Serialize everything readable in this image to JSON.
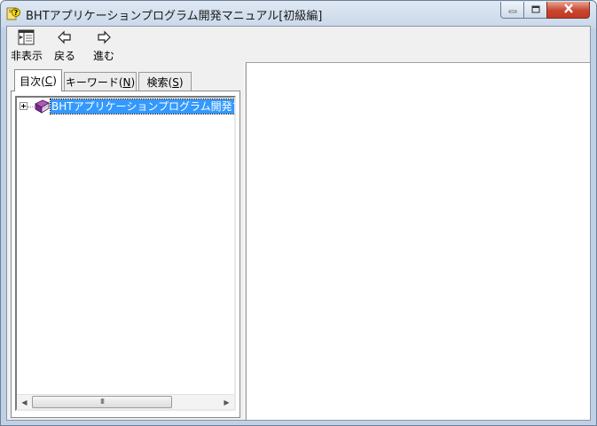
{
  "window": {
    "title": "BHTアプリケーションプログラム開発マニュアル[初級編]",
    "icons": {
      "app": "help-question-icon",
      "minimize": "minimize-icon",
      "maximize": "maximize-icon",
      "close": "close-icon"
    }
  },
  "toolbar": {
    "hide_label": "非表示",
    "back_label": "戻る",
    "forward_label": "進む",
    "icons": {
      "hide": "hide-pane-icon",
      "back": "back-arrow-icon",
      "forward": "forward-arrow-icon"
    }
  },
  "tabs": {
    "contents": {
      "text": "目次(",
      "key": "C",
      "end": ")"
    },
    "keyword": {
      "text": "キーワード(",
      "key": "N",
      "end": ")"
    },
    "search": {
      "text": "検索(",
      "key": "S",
      "end": ")"
    },
    "active": "contents"
  },
  "tree": {
    "nodes": [
      {
        "label": "BHTアプリケーションプログラム開発マニュ",
        "icon": "book-icon",
        "expanded": false,
        "selected": true
      }
    ]
  },
  "scrollbar": {
    "grip": "III"
  },
  "colors": {
    "selection": "#3399ff",
    "close_button": "#c9452e",
    "frame": "#c0d1e6"
  }
}
